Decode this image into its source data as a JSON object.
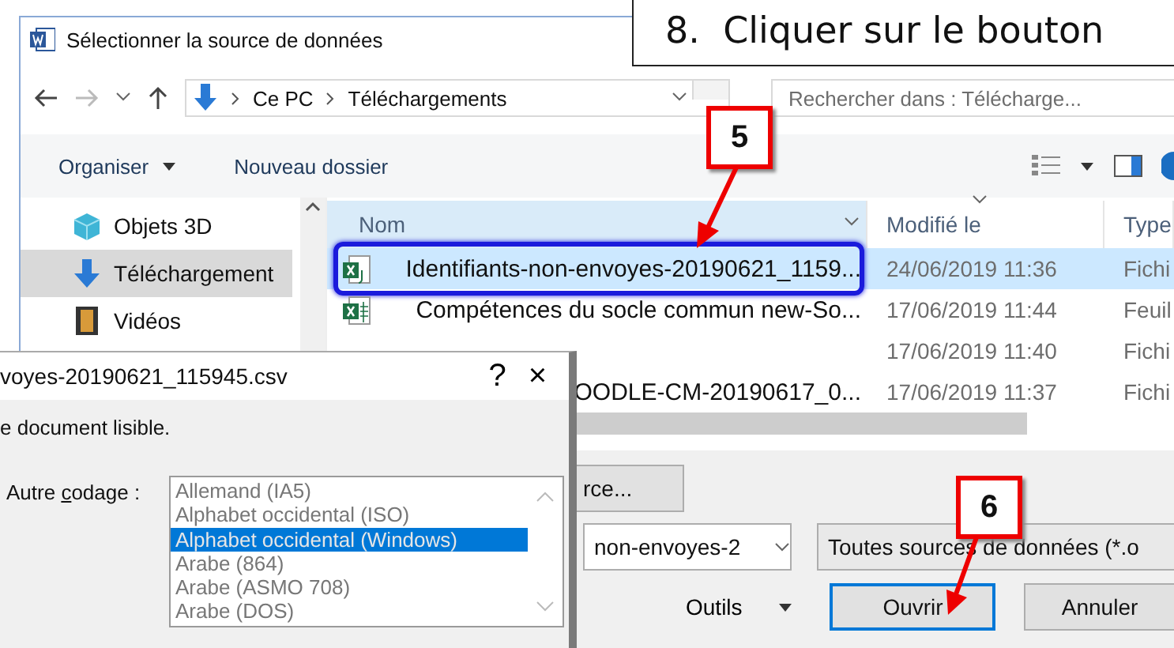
{
  "main_window": {
    "title": "Sélectionner la source de données",
    "path": [
      "Ce PC",
      "Téléchargements"
    ],
    "search": {
      "placeholder": "Rechercher dans : Télécharge..."
    },
    "toolbar": [
      {
        "label": "Organiser",
        "menu": true
      },
      {
        "label": "Nouveau dossier",
        "menu": false
      }
    ],
    "sidebar": {
      "items": [
        {
          "label": "Objets 3D",
          "kind": "cube",
          "selected": false
        },
        {
          "label": "Téléchargement",
          "kind": "download",
          "selected": true
        },
        {
          "label": "Vidéos",
          "kind": "film",
          "selected": false
        }
      ]
    },
    "file_list": {
      "columns": [
        "Nom",
        "Modifié le",
        "Type"
      ],
      "rows": [
        {
          "name": "Identifiants-non-envoyes-20190621_1159...",
          "kind": "csv",
          "modified": "24/06/2019 11:36",
          "type": "Fichi",
          "selected": true
        },
        {
          "name": "Compétences du socle commun new-So...",
          "kind": "sheet",
          "modified": "17/06/2019 11:44",
          "type": "Feuil",
          "selected": false
        },
        {
          "modified": "17/06/2019 11:40",
          "type": "Fichi",
          "selected": false
        },
        {
          "name": "OODLE-CM-20190617_0...",
          "modified": "17/06/2019 11:37",
          "type": "Fichi",
          "selected": false
        }
      ]
    },
    "browse_button": "rce...",
    "file_name": "non-envoyes-2",
    "file_type": "Toutes sources de données (*.o",
    "tools": "Outils",
    "open_button": "Ouvrir",
    "cancel_button": "Annuler"
  },
  "encoding_dialog": {
    "title": "voyes-20190621_115945.csv",
    "help": "?",
    "close": "×",
    "message": "e document lisible.",
    "label": {
      "before": "Autre ",
      "key": "c",
      "after": "odage :"
    },
    "encodings": [
      {
        "label": "Allemand (IA5)",
        "selected": false
      },
      {
        "label": "Alphabet occidental (ISO)",
        "selected": false
      },
      {
        "label": "Alphabet occidental (Windows)",
        "selected": true
      },
      {
        "label": "Arabe (864)",
        "selected": false
      },
      {
        "label": "Arabe (ASMO 708)",
        "selected": false
      },
      {
        "label": "Arabe (DOS)",
        "selected": false
      }
    ]
  },
  "instruction": "8.  Cliquer sur le bouton",
  "steps": [
    {
      "text": "5"
    },
    {
      "text": "6"
    }
  ]
}
